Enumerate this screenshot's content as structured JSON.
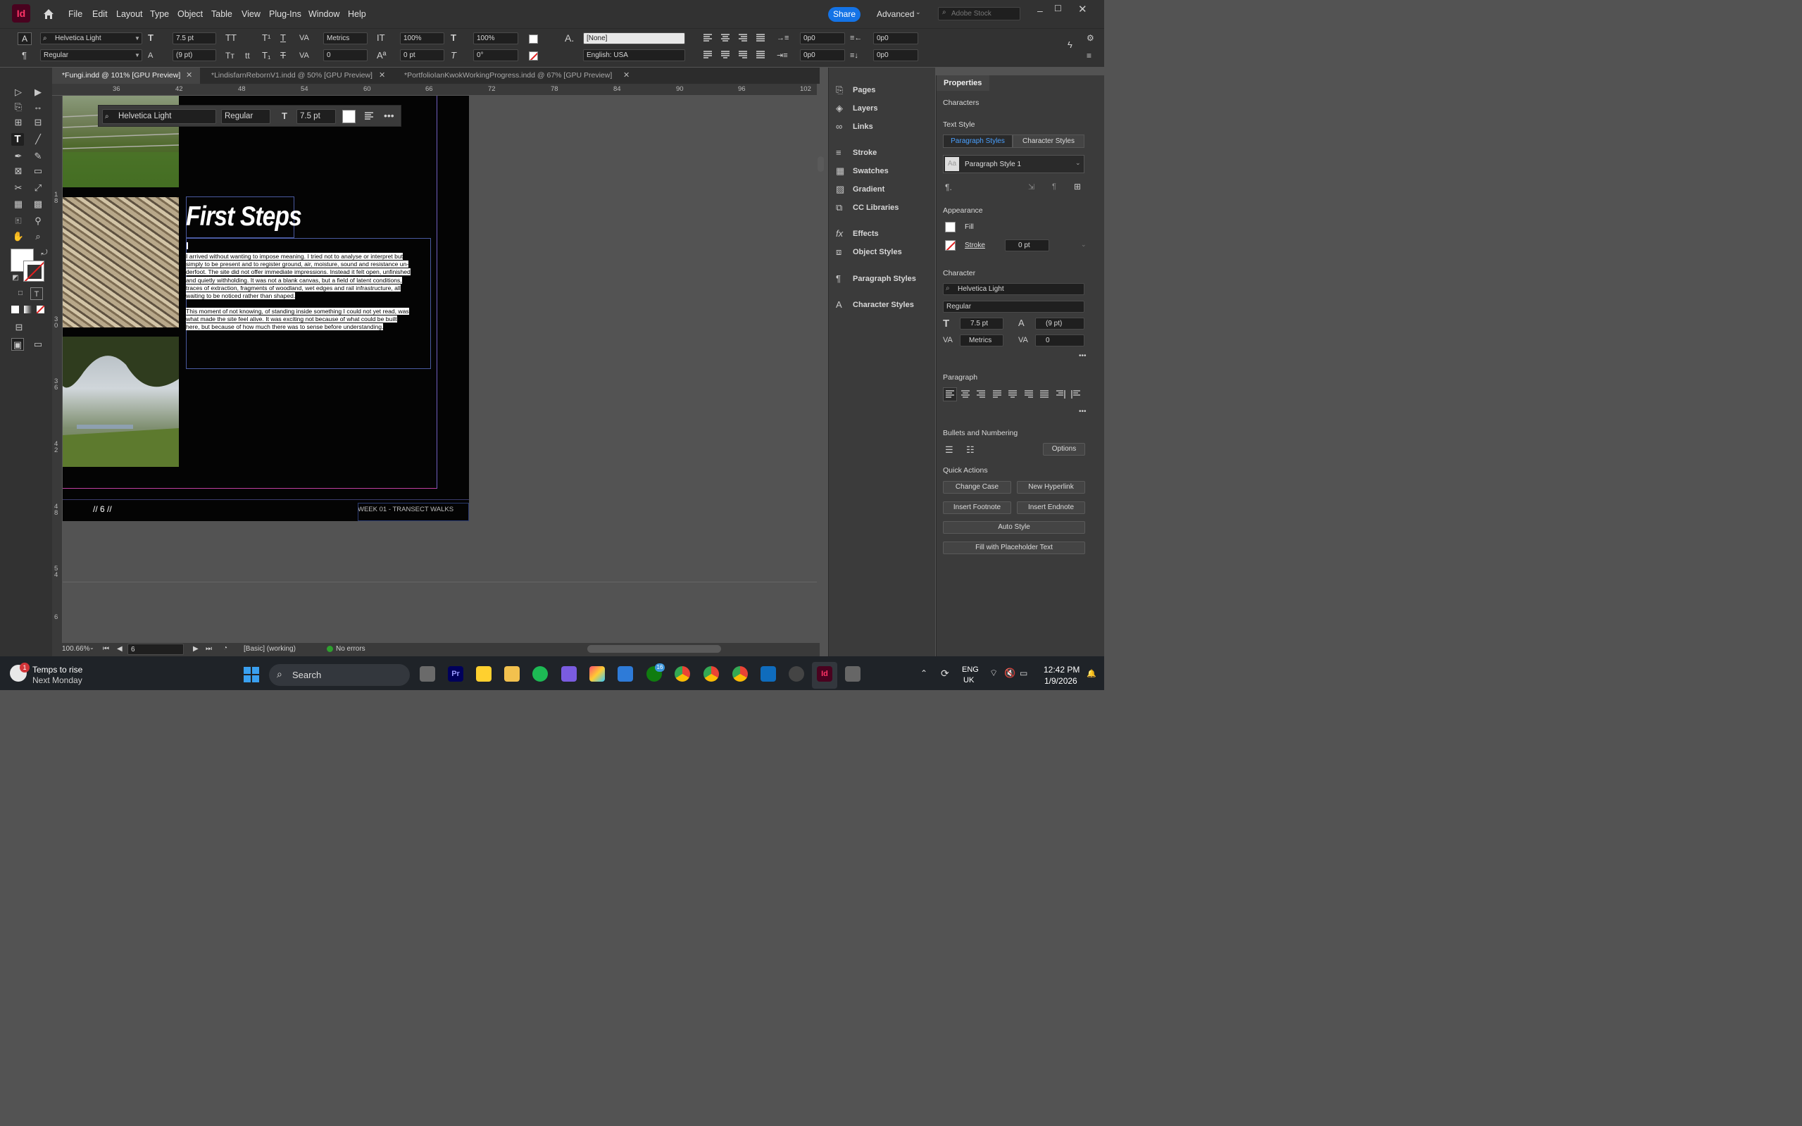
{
  "app": {
    "logo": "Id",
    "home_icon": "home-icon"
  },
  "menu": [
    "File",
    "Edit",
    "Layout",
    "Type",
    "Object",
    "Table",
    "View",
    "Plug-Ins",
    "Window",
    "Help"
  ],
  "topbar": {
    "share_label": "Share",
    "workspace": "Advanced",
    "stock_placeholder": "Adobe Stock"
  },
  "control": {
    "font_family": "Helvetica Light",
    "font_style": "Regular",
    "font_size": "7.5 pt",
    "leading": "(9 pt)",
    "kerning": "Metrics",
    "tracking": "0",
    "vscale": "100%",
    "hscale": "100%",
    "baseline": "0 pt",
    "skew": "0°",
    "char_style": "[None]",
    "language": "English: USA",
    "indent_1": "0p0",
    "indent_2": "0p0",
    "indent_3": "0p0",
    "indent_4": "0p0"
  },
  "tabs": [
    {
      "label": "*Fungi.indd @ 101% [GPU Preview]",
      "active": true
    },
    {
      "label": "*LindisfarnRebornV1.indd @ 50% [GPU Preview]",
      "active": false
    },
    {
      "label": "*PortfolioIanKwokWorkingProgress.indd @ 67% [GPU Preview]",
      "active": false
    }
  ],
  "ruler_h": [
    "36",
    "42",
    "48",
    "54",
    "60",
    "66",
    "72",
    "78",
    "84",
    "90",
    "96",
    "102"
  ],
  "ruler_v": [
    "1\n8",
    "3\n0",
    "3\n6",
    "4\n2",
    "4\n8",
    "5\n4",
    "6"
  ],
  "floatbar": {
    "font": "Helvetica Light",
    "style": "Regular",
    "size": "7.5 pt"
  },
  "document": {
    "heading": "First Steps",
    "para1": "I arrived without wanting to impose meaning. I tried not to analyse or interpret but simply to be present and to register ground, air, moisture, sound and resistance underfoot. The site did not offer immediate impressions. Instead it felt open, unfinished and quietly withholding. It was not a blank canvas, but a field of latent conditions, traces of extraction, fragments of woodland, wet edges and rail infrastructure, all waiting to be noticed rather than shaped.",
    "para1_lines": [
      "I arrived without wanting to impose meaning. I tried not to analyse or interpret but",
      "simply to be present and to register ground, air, moisture, sound and resistance un-",
      "derfoot. The site did not offer immediate impressions. Instead it felt open, unfinished",
      "and quietly withholding. It was not a blank canvas, but a field of latent conditions,",
      "traces of extraction, fragments of woodland, wet edges and rail infrastructure, all",
      "waiting to be noticed rather than shaped."
    ],
    "para2_lines": [
      "This moment of not knowing, of standing inside something I could not yet read, was",
      "what made the site feel alive. It was exciting not because of what could be built",
      "here, but because of how much there was to sense before understanding."
    ],
    "folio": "// 6 //",
    "running_footer": "WEEK 01 - TRANSECT WALKS"
  },
  "status": {
    "zoom": "100.66%",
    "page": "6",
    "preflight_profile": "[Basic] (working)",
    "errors": "No errors"
  },
  "panels": [
    "Pages",
    "Layers",
    "Links",
    "Stroke",
    "Swatches",
    "Gradient",
    "CC Libraries",
    "Effects",
    "Object Styles",
    "Paragraph Styles",
    "Character Styles"
  ],
  "properties": {
    "title": "Properties",
    "context": "Characters",
    "text_style_label": "Text Style",
    "tab_para": "Paragraph Styles",
    "tab_char": "Character Styles",
    "para_style": "Paragraph Style 1",
    "appearance_label": "Appearance",
    "fill_label": "Fill",
    "stroke_label": "Stroke",
    "stroke_weight": "0 pt",
    "character_label": "Character",
    "font_family": "Helvetica Light",
    "font_style": "Regular",
    "font_size": "7.5 pt",
    "leading": "(9 pt)",
    "kerning": "Metrics",
    "tracking": "0",
    "paragraph_label": "Paragraph",
    "bullets_label": "Bullets and Numbering",
    "options_label": "Options",
    "quick_actions_label": "Quick Actions",
    "qa": [
      "Change Case",
      "New Hyperlink",
      "Insert Footnote",
      "Insert Endnote",
      "Auto Style",
      "Fill with Placeholder Text"
    ]
  },
  "taskbar": {
    "weather_title": "Temps to rise",
    "weather_sub": "Next Monday",
    "weather_badge": "1",
    "search_label": "Search",
    "lang_1": "ENG",
    "lang_2": "UK",
    "time": "12:42 PM",
    "date": "1/9/2026",
    "xbox_badge": "16"
  },
  "colors": {
    "accent": "#1473e6",
    "indesign_logo_bg": "#49021f",
    "indesign_logo_fg": "#ff3366",
    "margin_guide": "#c040a0",
    "column_guide": "#7060c0"
  }
}
